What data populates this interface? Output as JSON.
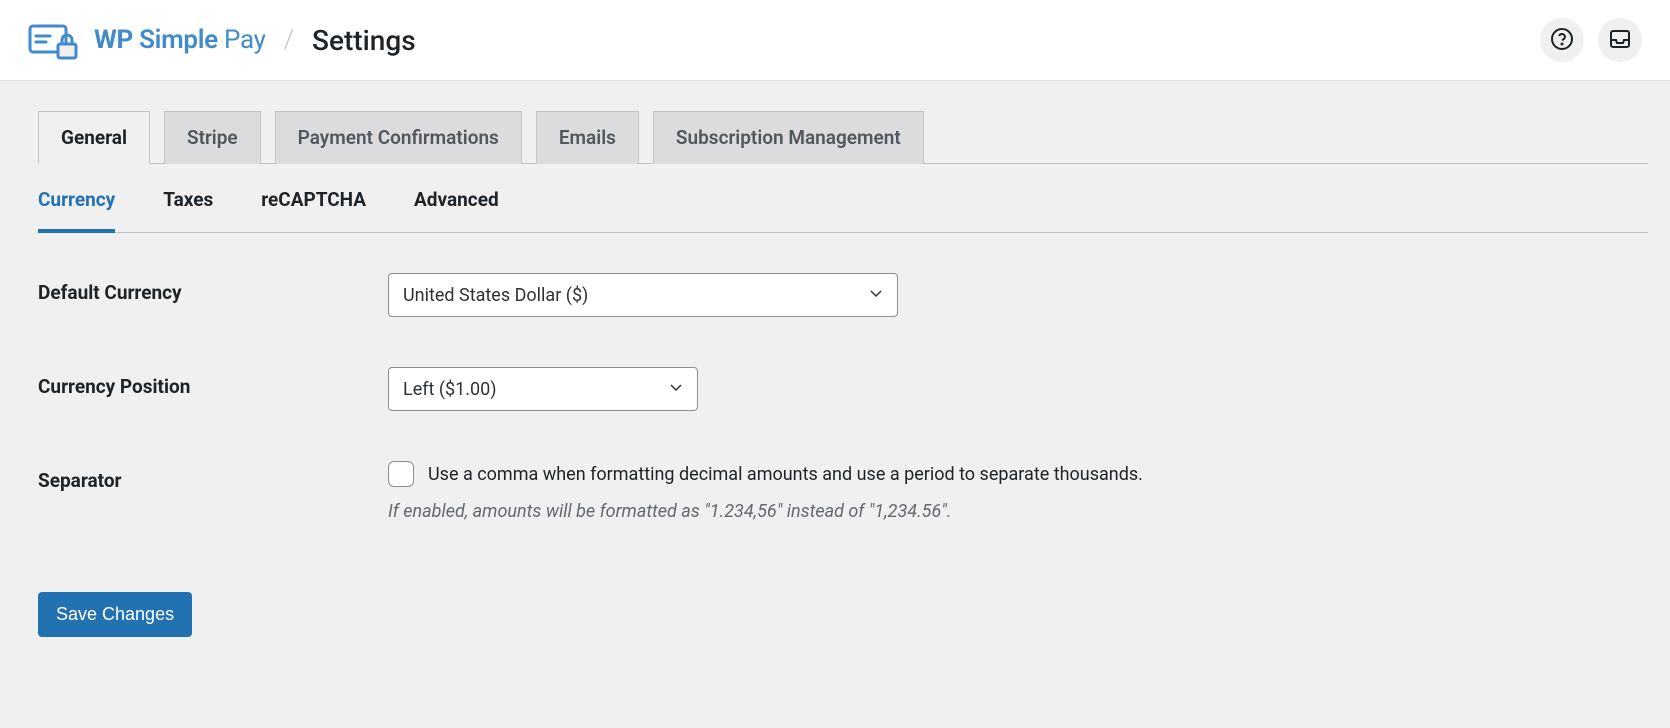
{
  "header": {
    "brand": "WP Simple Pay",
    "page_title": "Settings"
  },
  "tabs": {
    "primary": [
      {
        "label": "General",
        "active": true
      },
      {
        "label": "Stripe",
        "active": false
      },
      {
        "label": "Payment Confirmations",
        "active": false
      },
      {
        "label": "Emails",
        "active": false
      },
      {
        "label": "Subscription Management",
        "active": false
      }
    ],
    "secondary": [
      {
        "label": "Currency",
        "active": true
      },
      {
        "label": "Taxes",
        "active": false
      },
      {
        "label": "reCAPTCHA",
        "active": false
      },
      {
        "label": "Advanced",
        "active": false
      }
    ]
  },
  "form": {
    "default_currency": {
      "label": "Default Currency",
      "value": "United States Dollar ($)"
    },
    "currency_position": {
      "label": "Currency Position",
      "value": "Left ($1.00)"
    },
    "separator": {
      "label": "Separator",
      "checkbox_label": "Use a comma when formatting decimal amounts and use a period to separate thousands.",
      "help": "If enabled, amounts will be formatted as \"1.234,56\" instead of \"1,234.56\".",
      "checked": false
    },
    "save_button": "Save Changes"
  }
}
